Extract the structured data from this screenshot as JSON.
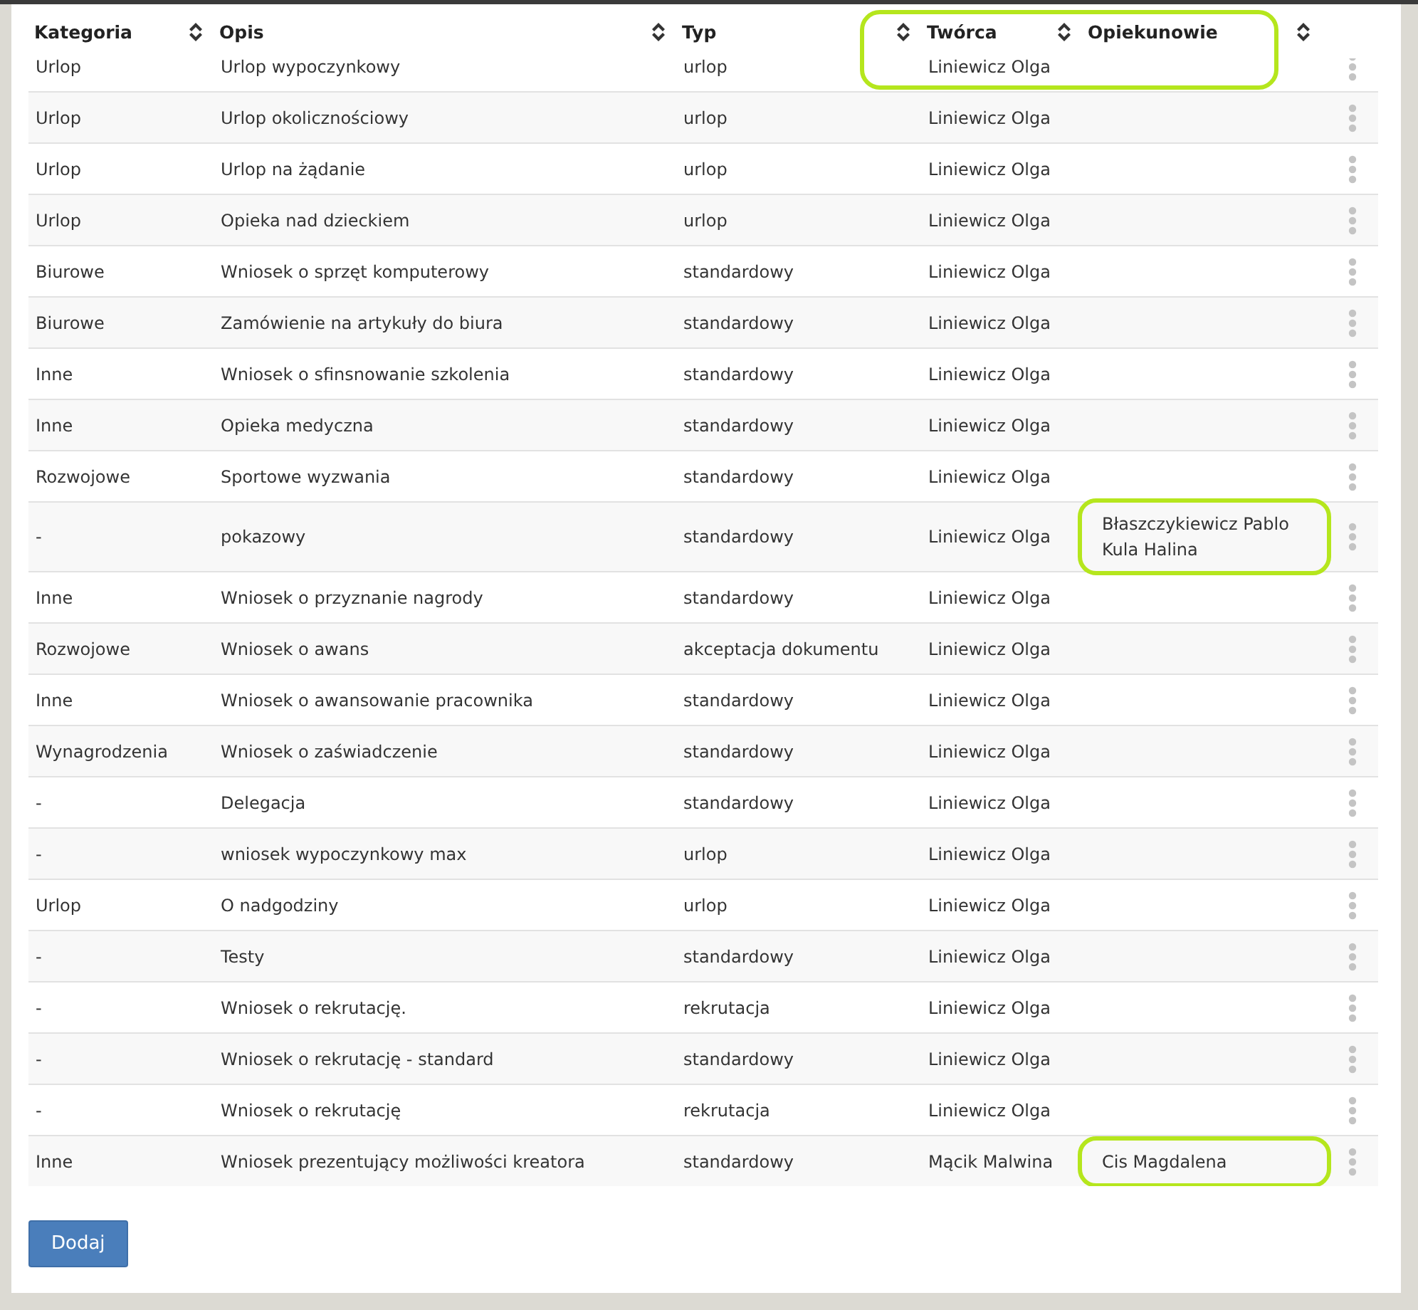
{
  "table": {
    "columns": [
      "Kategoria",
      "Opis",
      "Typ",
      "Twórca",
      "Opiekunowie"
    ],
    "rows": [
      {
        "category": "Urlop",
        "description": "Urlop wypoczynkowy",
        "type": "urlop",
        "creator": "Liniewicz Olga",
        "caretakers": []
      },
      {
        "category": "Urlop",
        "description": "Urlop okolicznościowy",
        "type": "urlop",
        "creator": "Liniewicz Olga",
        "caretakers": []
      },
      {
        "category": "Urlop",
        "description": "Urlop na żądanie",
        "type": "urlop",
        "creator": "Liniewicz Olga",
        "caretakers": []
      },
      {
        "category": "Urlop",
        "description": "Opieka nad dzieckiem",
        "type": "urlop",
        "creator": "Liniewicz Olga",
        "caretakers": []
      },
      {
        "category": "Biurowe",
        "description": "Wniosek o sprzęt komputerowy",
        "type": "standardowy",
        "creator": "Liniewicz Olga",
        "caretakers": []
      },
      {
        "category": "Biurowe",
        "description": "Zamówienie na artykuły do biura",
        "type": "standardowy",
        "creator": "Liniewicz Olga",
        "caretakers": []
      },
      {
        "category": "Inne",
        "description": "Wniosek o sfinsnowanie szkolenia",
        "type": "standardowy",
        "creator": "Liniewicz Olga",
        "caretakers": []
      },
      {
        "category": "Inne",
        "description": "Opieka medyczna",
        "type": "standardowy",
        "creator": "Liniewicz Olga",
        "caretakers": []
      },
      {
        "category": "Rozwojowe",
        "description": "Sportowe wyzwania",
        "type": "standardowy",
        "creator": "Liniewicz Olga",
        "caretakers": []
      },
      {
        "category": "-",
        "description": "pokazowy",
        "type": "standardowy",
        "creator": "Liniewicz Olga",
        "caretakers": [
          "Błaszczykiewicz Pablo",
          "Kula Halina"
        ],
        "highlighted": true
      },
      {
        "category": "Inne",
        "description": "Wniosek o przyznanie nagrody",
        "type": "standardowy",
        "creator": "Liniewicz Olga",
        "caretakers": []
      },
      {
        "category": "Rozwojowe",
        "description": "Wniosek o awans",
        "type": "akceptacja dokumentu",
        "creator": "Liniewicz Olga",
        "caretakers": []
      },
      {
        "category": "Inne",
        "description": "Wniosek o awansowanie pracownika",
        "type": "standardowy",
        "creator": "Liniewicz Olga",
        "caretakers": []
      },
      {
        "category": "Wynagrodzenia",
        "description": "Wniosek o zaświadczenie",
        "type": "standardowy",
        "creator": "Liniewicz Olga",
        "caretakers": []
      },
      {
        "category": "-",
        "description": "Delegacja",
        "type": "standardowy",
        "creator": "Liniewicz Olga",
        "caretakers": []
      },
      {
        "category": "-",
        "description": "wniosek wypoczynkowy max",
        "type": "urlop",
        "creator": "Liniewicz Olga",
        "caretakers": []
      },
      {
        "category": "Urlop",
        "description": "O nadgodziny",
        "type": "urlop",
        "creator": "Liniewicz Olga",
        "caretakers": []
      },
      {
        "category": "-",
        "description": "Testy",
        "type": "standardowy",
        "creator": "Liniewicz Olga",
        "caretakers": []
      },
      {
        "category": "-",
        "description": "Wniosek o rekrutację.",
        "type": "rekrutacja",
        "creator": "Liniewicz Olga",
        "caretakers": []
      },
      {
        "category": "-",
        "description": "Wniosek o rekrutację - standard",
        "type": "standardowy",
        "creator": "Liniewicz Olga",
        "caretakers": []
      },
      {
        "category": "-",
        "description": "Wniosek o rekrutację",
        "type": "rekrutacja",
        "creator": "Liniewicz Olga",
        "caretakers": []
      },
      {
        "category": "Inne",
        "description": "Wniosek prezentujący możliwości kreatora",
        "type": "standardowy",
        "creator": "Mącik Malwina",
        "caretakers": [
          "Cis Magdalena"
        ],
        "highlighted": true
      }
    ]
  },
  "add_button": "Dodaj"
}
